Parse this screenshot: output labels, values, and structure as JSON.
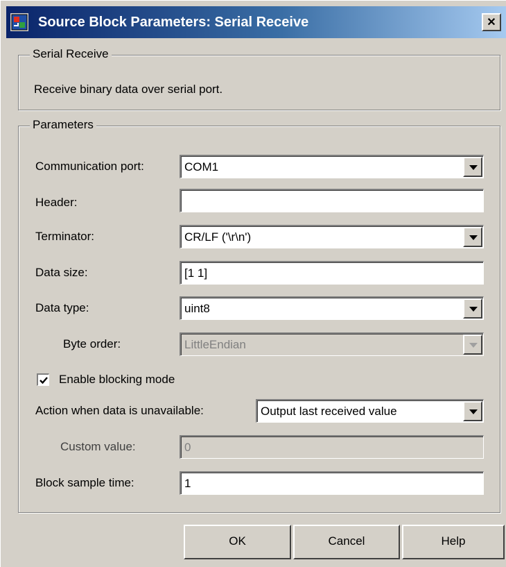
{
  "window": {
    "title": "Source Block Parameters: Serial Receive",
    "close_glyph": "✕",
    "icon": "simulink-block-icon"
  },
  "description_group": {
    "legend": "Serial Receive",
    "text": "Receive binary data over serial port."
  },
  "params_group": {
    "legend": "Parameters",
    "communication_port": {
      "label": "Communication port:",
      "value": "COM1"
    },
    "header": {
      "label": "Header:",
      "value": ""
    },
    "terminator": {
      "label": "Terminator:",
      "value": "CR/LF ('\\r\\n')"
    },
    "data_size": {
      "label": "Data size:",
      "value": "[1 1]"
    },
    "data_type": {
      "label": "Data type:",
      "value": "uint8"
    },
    "byte_order": {
      "label": "Byte order:",
      "value": "LittleEndian"
    },
    "enable_blocking": {
      "label": "Enable blocking mode",
      "checked": true
    },
    "action_unavailable": {
      "label": "Action when data is unavailable:",
      "value": "Output last received value"
    },
    "custom_value": {
      "label": "Custom value:",
      "value": "0"
    },
    "block_sample_time": {
      "label": "Block sample time:",
      "value": "1"
    }
  },
  "buttons": {
    "ok": "OK",
    "cancel": "Cancel",
    "help": "Help"
  }
}
